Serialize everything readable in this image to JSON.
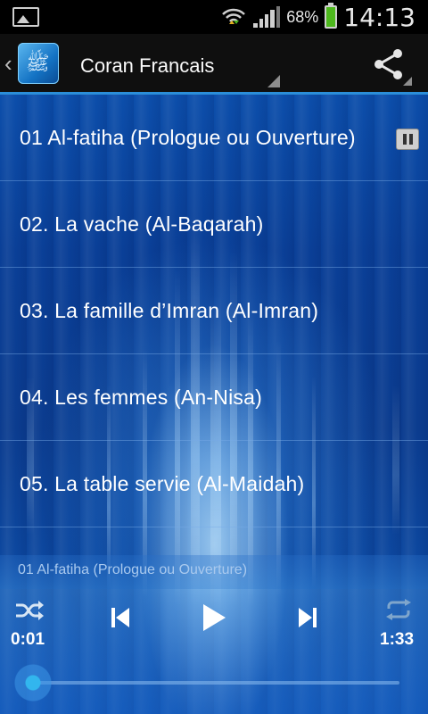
{
  "status_bar": {
    "battery_percent": "68%",
    "time": "14:13",
    "icons": [
      "gallery-icon",
      "wifi-icon",
      "signal-icon",
      "battery-charging-icon"
    ]
  },
  "action_bar": {
    "title": "Coran Francais",
    "icons": [
      "back-chevron-icon",
      "app-icon",
      "share-icon"
    ]
  },
  "tracks": [
    {
      "label": "01 Al-fatiha (Prologue ou Ouverture)"
    },
    {
      "label": "02. La vache (Al-Baqarah)"
    },
    {
      "label": "03. La famille d’Imran (Al-Imran)"
    },
    {
      "label": "04. Les femmes (An-Nisa)"
    },
    {
      "label": "05. La table servie (Al-Maidah)"
    }
  ],
  "player": {
    "now_playing": "01 Al-fatiha (Prologue ou Ouverture)",
    "elapsed": "0:01",
    "duration": "1:33",
    "progress_fraction": 0.01,
    "controls": [
      "shuffle-icon",
      "previous-icon",
      "play-icon",
      "next-icon",
      "repeat-icon"
    ]
  },
  "colors": {
    "accent": "#2b8ed9",
    "status_bar_bg": "#000000",
    "action_bar_bg": "#0f0f0f",
    "seek_thumb": "#32b6ee",
    "battery": "#4db81d"
  }
}
